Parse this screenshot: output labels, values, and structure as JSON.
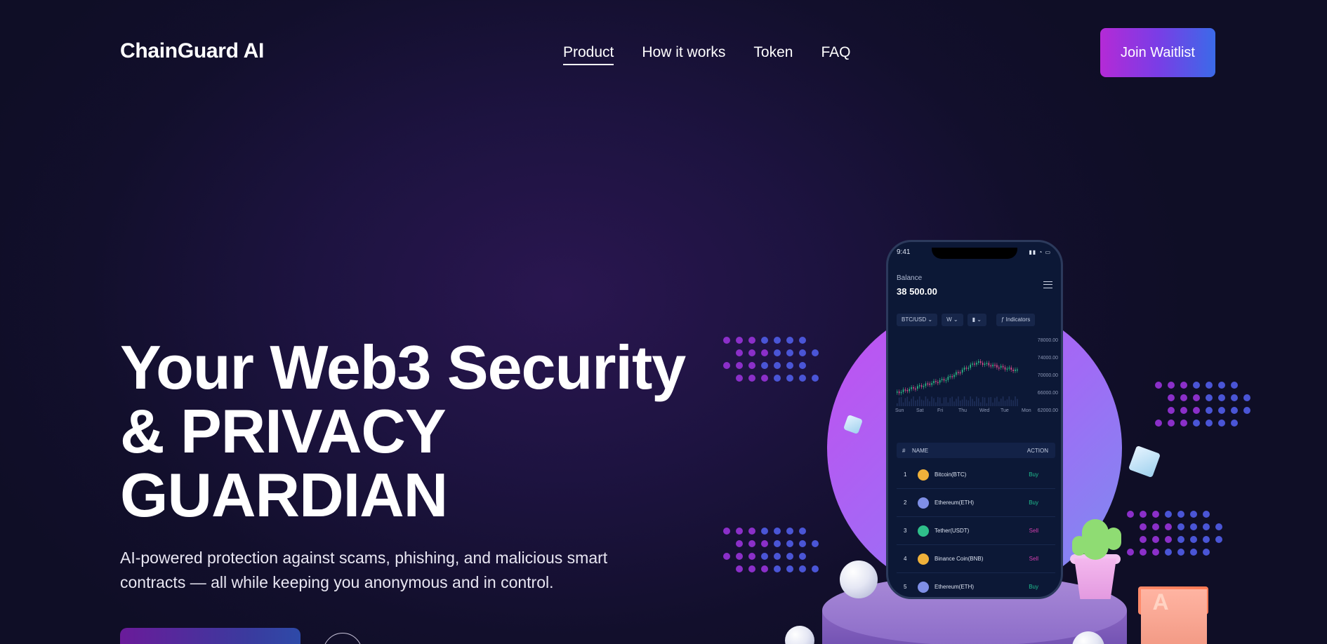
{
  "brand": "ChainGuard AI",
  "nav": {
    "items": [
      "Product",
      "How it works",
      "Token",
      "FAQ"
    ],
    "active": "Product",
    "cta": "Join Waitlist"
  },
  "hero": {
    "title_line1": "Your Web3 Security",
    "title_line2": "& PRIVACY",
    "title_line3": "GUARDIAN",
    "subtitle": "AI-powered protection against scams, phishing, and malicious smart contracts — all while keeping you anonymous and in control."
  },
  "phone": {
    "time": "9:41",
    "balance_label": "Balance",
    "balance_value": "38 500.00",
    "chips": [
      "BTC/USD",
      "W",
      "Indicators"
    ],
    "y_ticks": [
      "78000.00",
      "74000.00",
      "70000.00",
      "66000.00",
      "62000.00"
    ],
    "x_ticks": [
      "Sun",
      "Sat",
      "Fri",
      "Thu",
      "Wed",
      "Tue",
      "Mon"
    ],
    "table": {
      "headers": [
        "#",
        "NAME",
        "ACTION"
      ],
      "rows": [
        {
          "n": "1",
          "name": "Bitcoin(BTC)",
          "action": "Buy",
          "color": "#f0b13a"
        },
        {
          "n": "2",
          "name": "Ethereum(ETH)",
          "action": "Buy",
          "color": "#7f8fe6"
        },
        {
          "n": "3",
          "name": "Tether(USDT)",
          "action": "Sell",
          "color": "#2fbf8a"
        },
        {
          "n": "4",
          "name": "Binance Coin(BNB)",
          "action": "Sell",
          "color": "#f0b13a"
        },
        {
          "n": "5",
          "name": "Ethereum(ETH)",
          "action": "Buy",
          "color": "#7f8fe6"
        }
      ]
    }
  },
  "decor": {
    "block_letter": "A"
  },
  "colors": {
    "accent_purple": "#b42ad6",
    "accent_blue": "#3b6ae8",
    "buy": "#1fbf8f",
    "sell": "#d63fb0"
  }
}
